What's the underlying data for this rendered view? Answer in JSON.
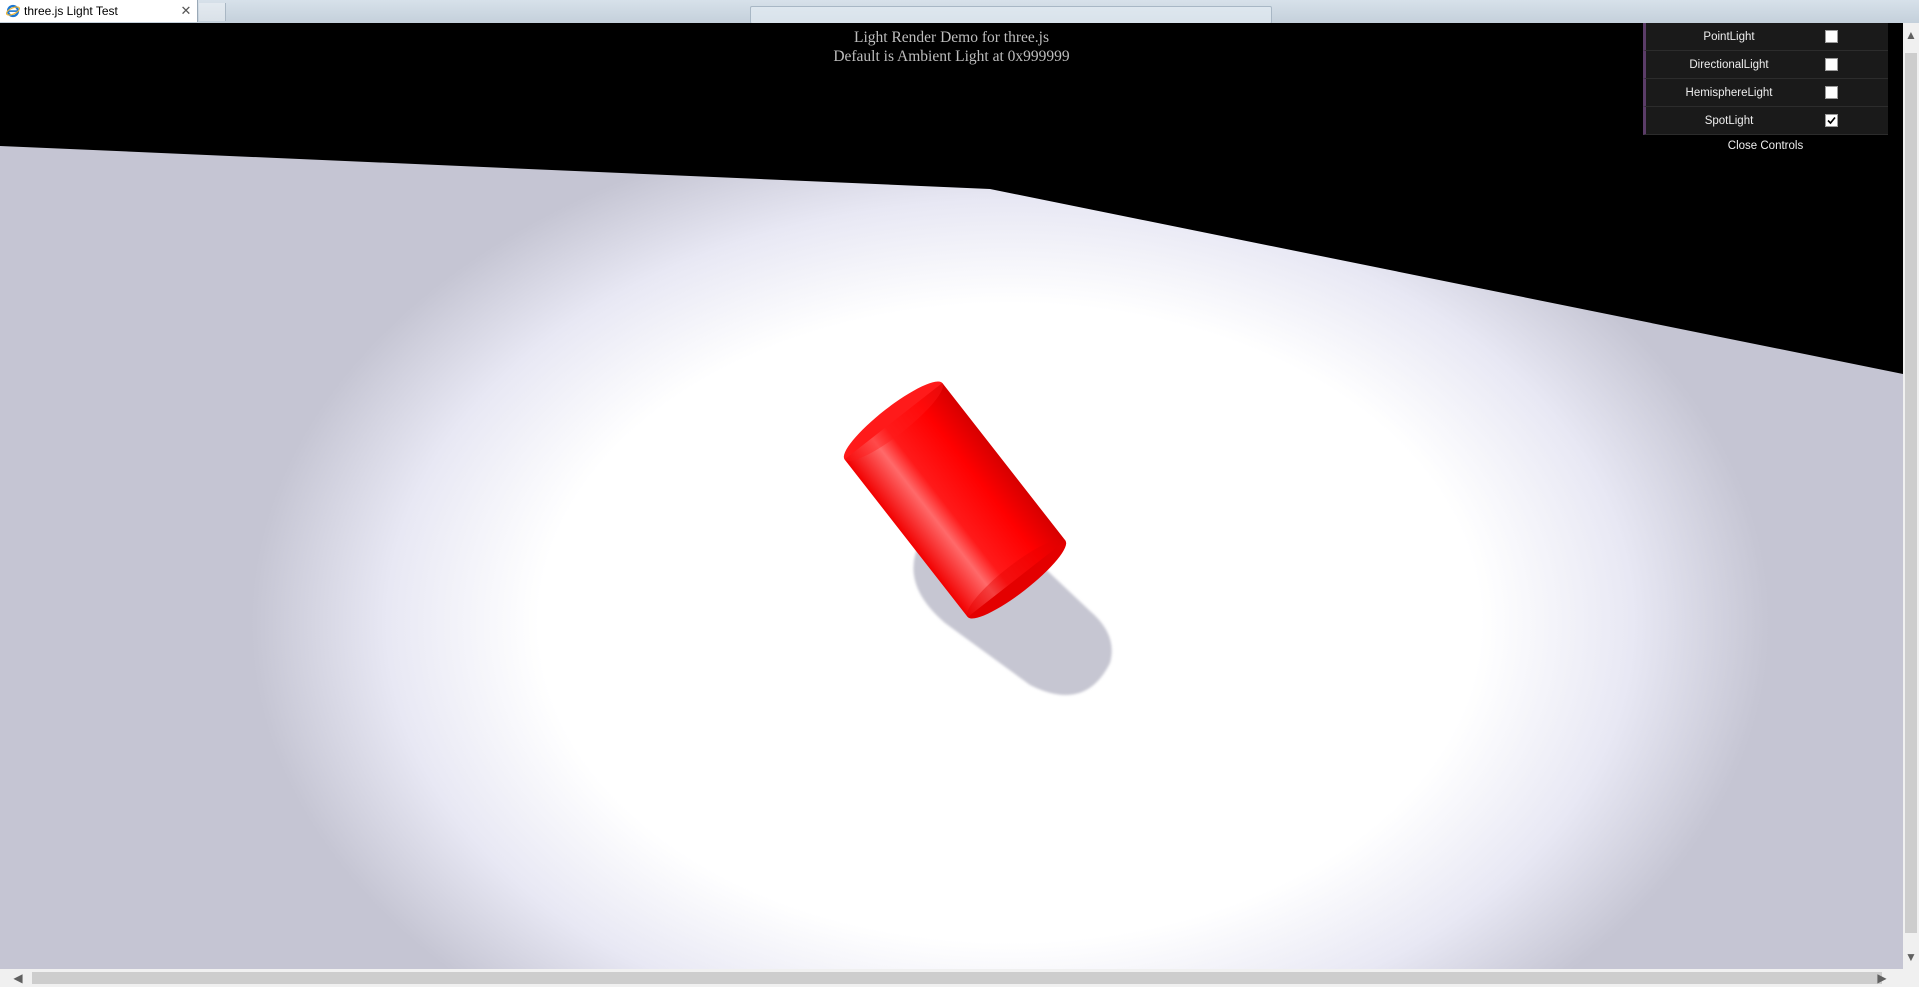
{
  "browser": {
    "tab_title": "three.js Light Test",
    "tab_close": "✕"
  },
  "info": {
    "line1": "Light Render Demo for three.js",
    "line2": "Default is Ambient Light at 0x999999"
  },
  "controls": {
    "items": [
      {
        "label": "PointLight",
        "checked": false
      },
      {
        "label": "DirectionalLight",
        "checked": false
      },
      {
        "label": "HemisphereLight",
        "checked": false
      },
      {
        "label": "SpotLight",
        "checked": true
      }
    ],
    "close_label": "Close Controls"
  },
  "scene": {
    "background": "#000000",
    "floor_color": "#c5c5d3",
    "spotlight_color": "#ffffff",
    "cylinder_color": "#ff0000",
    "shadow_color": "#c6c6d2"
  },
  "scrollbars": {
    "up": "▲",
    "down": "▼",
    "left": "◀",
    "right": "▶"
  }
}
